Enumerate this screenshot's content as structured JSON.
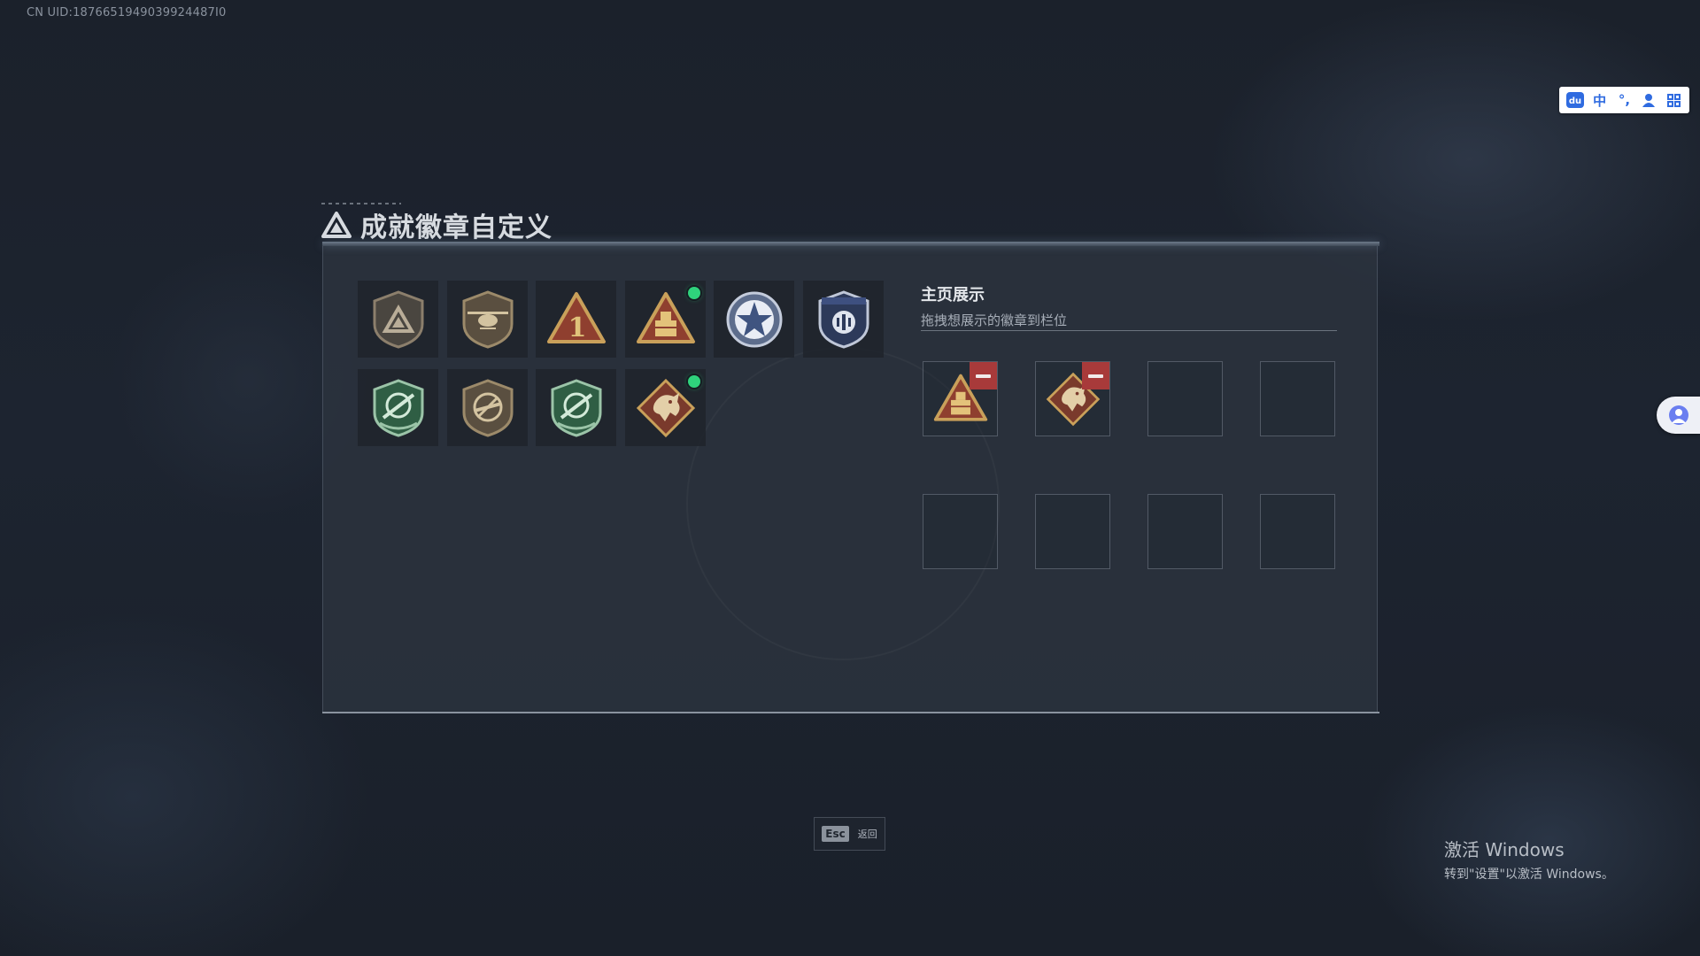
{
  "uid_text": "CN UID:1876651949039924487I0",
  "title": "成就徽章自定义",
  "display": {
    "title": "主页展示",
    "subtitle": "拖拽想展示的徽章到栏位"
  },
  "esc": {
    "key": "Esc",
    "label": "返回"
  },
  "ime": {
    "items": [
      "du",
      "中",
      "°,",
      "profile",
      "grid"
    ]
  },
  "windows_activation": {
    "title": "激活 Windows",
    "subtitle": "转到\"设置\"以激活 Windows。"
  },
  "badges": [
    {
      "name": "triangle-shield-badge",
      "new": false
    },
    {
      "name": "helicopter-shield-badge",
      "new": false
    },
    {
      "name": "rank-one-triangle-badge",
      "new": false
    },
    {
      "name": "supply-box-triangle-badge",
      "new": true
    },
    {
      "name": "star-emblem-badge",
      "new": false
    },
    {
      "name": "police-shield-badge",
      "new": false
    },
    {
      "name": "green-rifle-shield-badge",
      "new": false
    },
    {
      "name": "no-rifle-shield-badge",
      "new": false
    },
    {
      "name": "green-rifle-shield-badge-2",
      "new": false
    },
    {
      "name": "dragon-diamond-badge",
      "new": true
    }
  ],
  "display_slots": [
    {
      "badge": "supply-box-triangle-badge"
    },
    {
      "badge": "dragon-diamond-badge"
    },
    {
      "badge": null
    },
    {
      "badge": null
    },
    {
      "badge": null
    },
    {
      "badge": null
    },
    {
      "badge": null
    },
    {
      "badge": null
    }
  ],
  "colors": {
    "new_dot": "#2fd27c",
    "remove": "#a83a3a",
    "gold": "#c9a05a",
    "green": "#3f7a57"
  }
}
